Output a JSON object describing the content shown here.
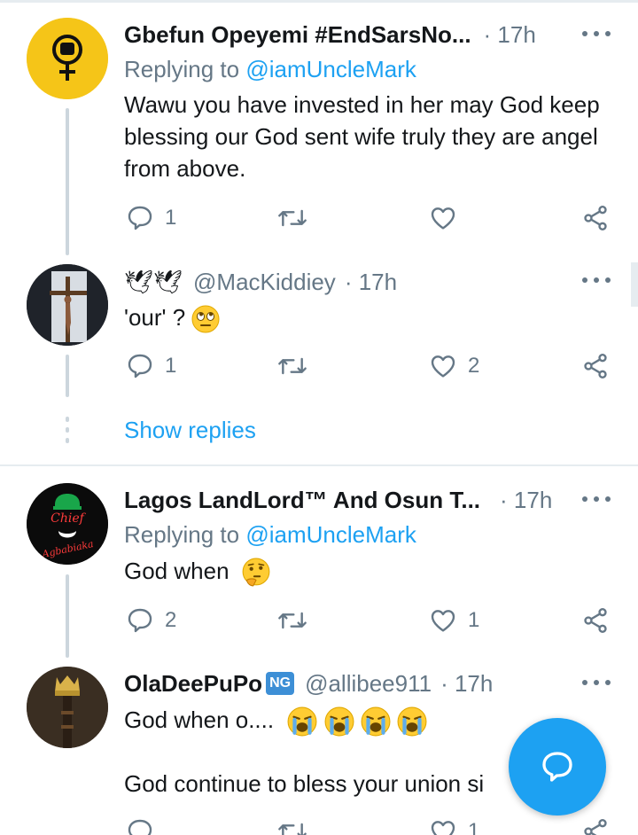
{
  "tweets": [
    {
      "name": "Gbefun Opeyemi #EndSarsNo...",
      "handle": "",
      "time": "· 17h",
      "replying_label": "Replying to ",
      "replying_handle": "@iamUncleMark",
      "text": "Wawu you have invested in her may God keep blessing our God sent wife truly they are angel from above.",
      "reply_count": "1",
      "retweet_count": "",
      "like_count": ""
    },
    {
      "name": "🕊🕊",
      "handle": "@MacKiddiey",
      "time": "· 17h",
      "text": "'our' ?",
      "reply_count": "1",
      "retweet_count": "",
      "like_count": "2"
    },
    {
      "name": "Lagos LandLord™ And Osun T...",
      "handle": "",
      "time": "· 17h",
      "replying_label": "Replying to ",
      "replying_handle": "@iamUncleMark",
      "text": "God when",
      "reply_count": "2",
      "retweet_count": "",
      "like_count": "1"
    },
    {
      "name": "OlaDeePuPo",
      "badge": "NG",
      "handle": "@allibee911",
      "time": "· 17h",
      "text_line1": "God when o....",
      "text_line2": "God continue to bless your union si",
      "reply_count": "",
      "retweet_count": "",
      "like_count": "1"
    }
  ],
  "show_replies_label": "Show replies",
  "avatar_text": {
    "chief": "Chief",
    "agbabiaka": "Agbabiaka"
  },
  "icons": {
    "reply": "reply-icon",
    "retweet": "retweet-icon",
    "like": "heart-icon",
    "share": "share-icon",
    "more": "more-icon",
    "compose": "compose-reply-icon"
  },
  "colors": {
    "accent": "#1da1f2",
    "muted": "#657786",
    "text": "#14171a",
    "border": "#e6ecf0"
  }
}
